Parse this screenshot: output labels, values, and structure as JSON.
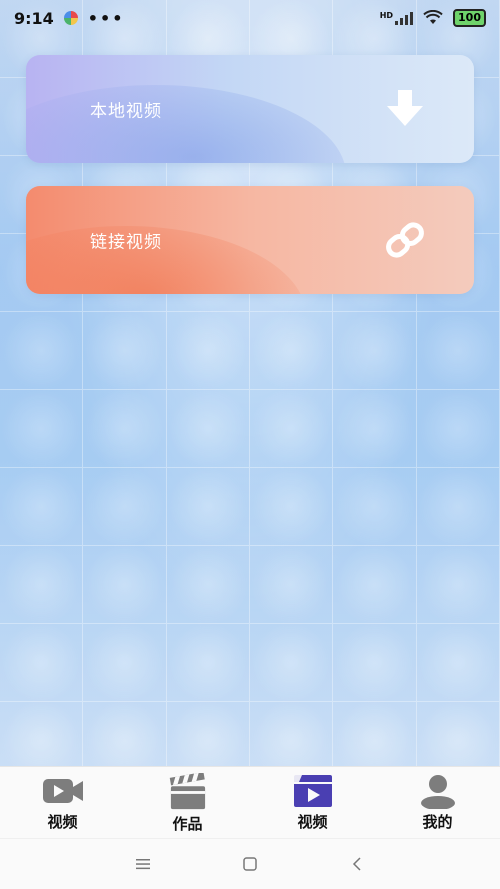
{
  "status_bar": {
    "time": "9:14",
    "dots": "•••",
    "network": "HD",
    "battery": "100"
  },
  "cards": [
    {
      "label": "本地视频",
      "icon": "download-arrow-icon"
    },
    {
      "label": "链接视频",
      "icon": "link-icon"
    }
  ],
  "tabs": [
    {
      "label": "视频",
      "icon": "video-camera-icon"
    },
    {
      "label": "作品",
      "icon": "clapperboard-icon"
    },
    {
      "label": "视频",
      "icon": "video-play-icon"
    },
    {
      "label": "我的",
      "icon": "user-icon"
    }
  ],
  "colors": {
    "accent": "#4a3fb2",
    "tab_icon_gray": "#7d7d7d"
  }
}
